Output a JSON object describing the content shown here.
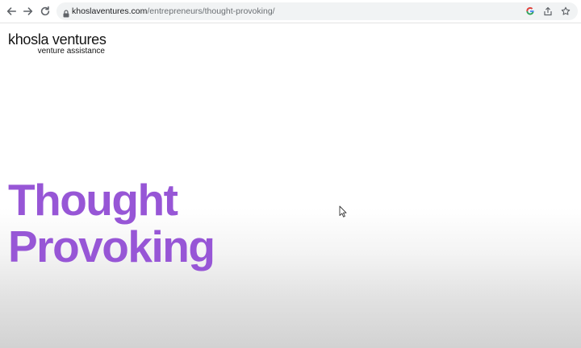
{
  "browser": {
    "url_host": "khoslaventures.com",
    "url_path": "/entrepreneurs/thought-provoking/",
    "nav_icons": [
      "back-arrow-icon",
      "forward-arrow-icon",
      "reload-icon"
    ],
    "omnibox_icons": [
      "lock-icon",
      "google-icon",
      "share-icon",
      "star-icon"
    ]
  },
  "logo": {
    "main": "khosla ventures",
    "sub": "venture assistance"
  },
  "hero": {
    "line1": "Thought",
    "line2": "Provoking",
    "color": "#9756d6"
  }
}
